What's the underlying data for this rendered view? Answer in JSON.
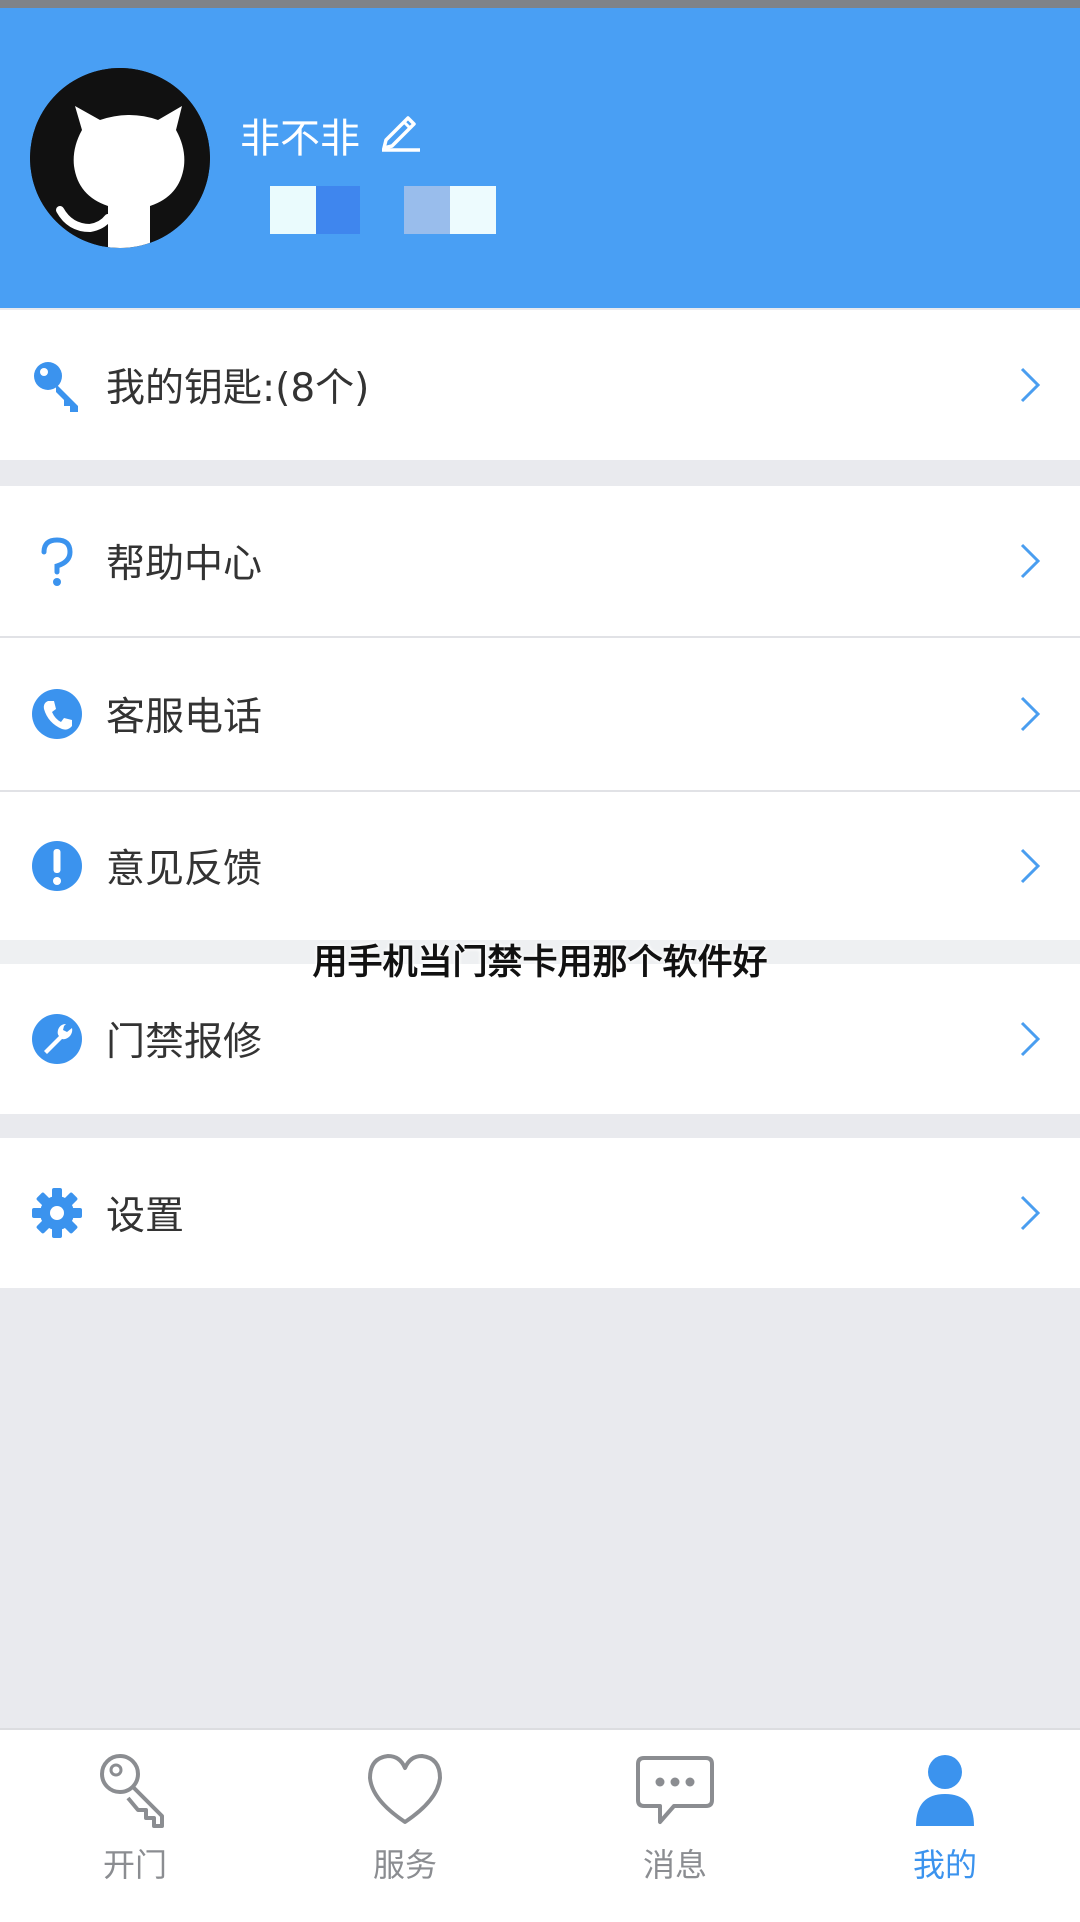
{
  "profile": {
    "username": "非不非"
  },
  "menu": [
    {
      "label": "我的钥匙:(8个)",
      "icon": "key-icon"
    },
    {
      "label": "帮助中心",
      "icon": "question-icon"
    },
    {
      "label": "客服电话",
      "icon": "phone-icon"
    },
    {
      "label": "意见反馈",
      "icon": "exclamation-icon"
    },
    {
      "label": "门禁报修",
      "icon": "wrench-icon"
    },
    {
      "label": "设置",
      "icon": "gear-icon"
    }
  ],
  "overlay": {
    "caption": "用手机当门禁卡用那个软件好"
  },
  "tabs": [
    {
      "label": "开门",
      "icon": "key-icon"
    },
    {
      "label": "服务",
      "icon": "heart-icon"
    },
    {
      "label": "消息",
      "icon": "chat-bubble-icon"
    },
    {
      "label": "我的",
      "icon": "person-icon",
      "active": true
    }
  ],
  "colors": {
    "header": "#499ff4",
    "accent": "#3b93ee",
    "tab_inactive": "#8b8d91"
  }
}
